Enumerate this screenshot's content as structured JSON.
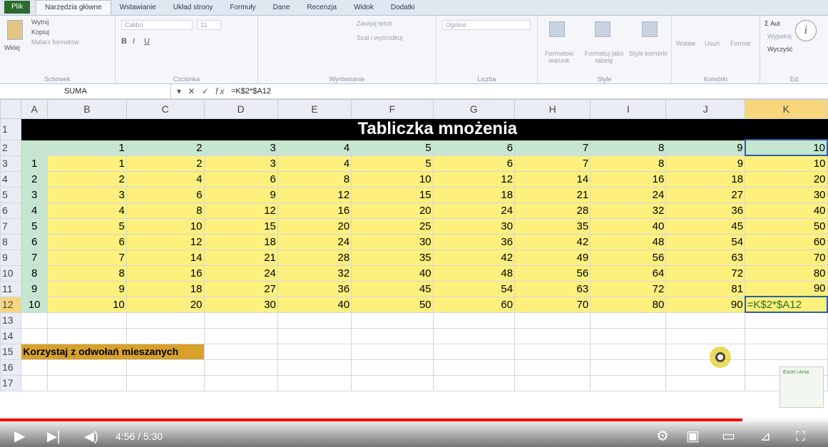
{
  "ribbon_tabs": [
    "Plik",
    "Narzędzia główne",
    "Wstawianie",
    "Układ strony",
    "Formuły",
    "Dane",
    "Recenzja",
    "Widok",
    "Dodatki"
  ],
  "ribbon": {
    "clipboard": {
      "paste": "Wklej",
      "cut": "Wytnij",
      "copy": "Kopiuj",
      "painter": "Malarz formatów",
      "label": "Schowek"
    },
    "font": {
      "name": "Calibri",
      "size": "11",
      "label": "Czcionka"
    },
    "alignment": {
      "wrap": "Zawijaj tekst",
      "merge": "Scal i wyśrodkuj",
      "label": "Wyrównanie"
    },
    "number": {
      "format": "Ogólne",
      "label": "Liczba"
    },
    "styles": {
      "cond": "Formatow. warunk.",
      "table": "Formatuj jako tabelę",
      "cell": "Style komórki",
      "label": "Style"
    },
    "cells": {
      "insert": "Wstaw",
      "delete": "Usuń",
      "format": "Format",
      "label": "Komórki"
    },
    "editing": {
      "autosum": "Aut",
      "fill": "Wypełnij",
      "clear": "Wyczyść",
      "label": "Ed"
    }
  },
  "formula_bar": {
    "name_box": "SUMA",
    "formula": "=K$2*$A12"
  },
  "columns": [
    "A",
    "B",
    "C",
    "D",
    "E",
    "F",
    "G",
    "H",
    "I",
    "J",
    "K"
  ],
  "sheet": {
    "title": "Tabliczka mnożenia",
    "header_row": [
      "1",
      "2",
      "3",
      "4",
      "5",
      "6",
      "7",
      "8",
      "9",
      "10"
    ],
    "rows": [
      [
        "1",
        "1",
        "2",
        "3",
        "4",
        "5",
        "6",
        "7",
        "8",
        "9",
        "10"
      ],
      [
        "2",
        "2",
        "4",
        "6",
        "8",
        "10",
        "12",
        "14",
        "16",
        "18",
        "20"
      ],
      [
        "3",
        "3",
        "6",
        "9",
        "12",
        "15",
        "18",
        "21",
        "24",
        "27",
        "30"
      ],
      [
        "4",
        "4",
        "8",
        "12",
        "16",
        "20",
        "24",
        "28",
        "32",
        "36",
        "40"
      ],
      [
        "5",
        "5",
        "10",
        "15",
        "20",
        "25",
        "30",
        "35",
        "40",
        "45",
        "50"
      ],
      [
        "6",
        "6",
        "12",
        "18",
        "24",
        "30",
        "36",
        "42",
        "48",
        "54",
        "60"
      ],
      [
        "7",
        "7",
        "14",
        "21",
        "28",
        "35",
        "42",
        "49",
        "56",
        "63",
        "70"
      ],
      [
        "8",
        "8",
        "16",
        "24",
        "32",
        "40",
        "48",
        "56",
        "64",
        "72",
        "80"
      ],
      [
        "9",
        "9",
        "18",
        "27",
        "36",
        "45",
        "54",
        "63",
        "72",
        "81",
        "90"
      ],
      [
        "10",
        "10",
        "20",
        "30",
        "40",
        "50",
        "60",
        "70",
        "80",
        "90",
        "=K$2*$A12"
      ]
    ],
    "note": "Korzystaj z odwołań mieszanych",
    "row_numbers": [
      "1",
      "2",
      "3",
      "4",
      "5",
      "6",
      "7",
      "8",
      "9",
      "10",
      "11",
      "12",
      "13",
      "14",
      "15",
      "16",
      "17"
    ]
  },
  "player": {
    "time": "4:56 / 5:30",
    "progress": 0.897
  },
  "thumb_text": "Excel i Ania",
  "info_icon": "i"
}
